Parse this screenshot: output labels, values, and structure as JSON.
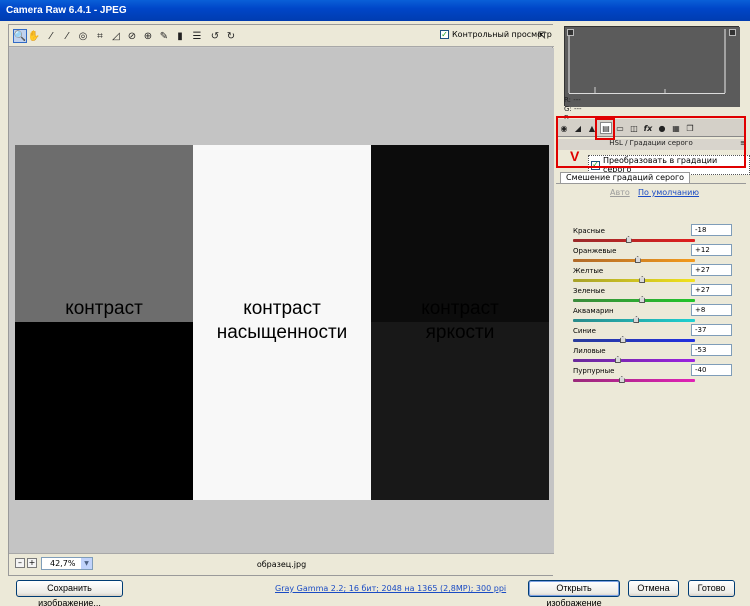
{
  "window": {
    "title": "Camera Raw 6.4.1 - JPEG"
  },
  "toolbar": {
    "tools": [
      {
        "name": "zoom-tool",
        "icon": "magnifier-icon",
        "glyph": "🔍"
      },
      {
        "name": "hand-tool",
        "icon": "hand-icon",
        "glyph": "✋"
      },
      {
        "name": "white-balance-tool",
        "icon": "eyedropper-icon",
        "glyph": "⁄"
      },
      {
        "name": "color-sampler-tool",
        "icon": "color-sampler-icon",
        "glyph": "⁄"
      },
      {
        "name": "targeted-adjustment-tool",
        "icon": "target-icon",
        "glyph": "◎"
      },
      {
        "name": "crop-tool",
        "icon": "crop-icon",
        "glyph": "⌗"
      },
      {
        "name": "straighten-tool",
        "icon": "straighten-icon",
        "glyph": "◿"
      },
      {
        "name": "spot-removal-tool",
        "icon": "spot-removal-icon",
        "glyph": "⊘"
      },
      {
        "name": "red-eye-tool",
        "icon": "red-eye-icon",
        "glyph": "⊕"
      },
      {
        "name": "adjustment-brush-tool",
        "icon": "brush-icon",
        "glyph": "✎"
      },
      {
        "name": "graduated-filter-tool",
        "icon": "graduated-filter-icon",
        "glyph": "▮"
      },
      {
        "name": "preferences-tool",
        "icon": "list-icon",
        "glyph": "☰"
      },
      {
        "name": "rotate-ccw-tool",
        "icon": "rotate-left-icon",
        "glyph": "↺"
      },
      {
        "name": "rotate-cw-tool",
        "icon": "rotate-right-icon",
        "glyph": "↻"
      }
    ],
    "preview_label": "Контрольный просмотр",
    "preview_checked": true
  },
  "image": {
    "labels": {
      "contrast": "контраст",
      "saturation_contrast_line1": "контраст",
      "saturation_contrast_line2": "насыщенности",
      "brightness_contrast_line1": "контраст",
      "brightness_contrast_line2": "яркости"
    },
    "colors": {
      "top_left": "#6d6d6d",
      "bottom_left": "#000000",
      "middle": "#f8f8f8",
      "top_right": "#0c0c0c",
      "bottom_right": "#181818"
    }
  },
  "status": {
    "minus": "–",
    "plus": "+",
    "zoom": "42,7%",
    "filename": "образец.jpg"
  },
  "histogram": {
    "r": "R:  ---",
    "g": "G:  ---",
    "b": "B:"
  },
  "panel": {
    "title": "HSL / Градации серого",
    "menu": "≡",
    "convert_label": "Преобразовать в градации серого",
    "convert_checked": true,
    "annotation_mark": "V",
    "subtab": "Смешение градаций серого",
    "auto": "Авто",
    "default": "По умолчанию",
    "sliders": [
      {
        "label": "Красные",
        "value": "-18",
        "gradient": "linear-gradient(90deg,#9a2b2b,#e01e1e)"
      },
      {
        "label": "Оранжевые",
        "value": "+12",
        "gradient": "linear-gradient(90deg,#b06a2a,#f39a1c)"
      },
      {
        "label": "Желтые",
        "value": "+27",
        "gradient": "linear-gradient(90deg,#a7a12a,#f2e21c)"
      },
      {
        "label": "Зеленые",
        "value": "+27",
        "gradient": "linear-gradient(90deg,#3c8a3c,#22c52a)"
      },
      {
        "label": "Аквамарин",
        "value": "+8",
        "gradient": "linear-gradient(90deg,#2a8a8a,#1ed0d0)"
      },
      {
        "label": "Синие",
        "value": "-37",
        "gradient": "linear-gradient(90deg,#2a3c9a,#2230e0)"
      },
      {
        "label": "Лиловые",
        "value": "-53",
        "gradient": "linear-gradient(90deg,#6a2a9a,#9a22e0)"
      },
      {
        "label": "Пурпурные",
        "value": "-40",
        "gradient": "linear-gradient(90deg,#9a2a7a,#e022b6)"
      }
    ]
  },
  "bottom": {
    "save": "Сохранить изображение...",
    "info": "Gray Gamma 2.2; 16 бит; 2048 на 1365 (2,8MP); 300 ppi",
    "open": "Открыть изображение",
    "cancel": "Отмена",
    "done": "Готово"
  }
}
